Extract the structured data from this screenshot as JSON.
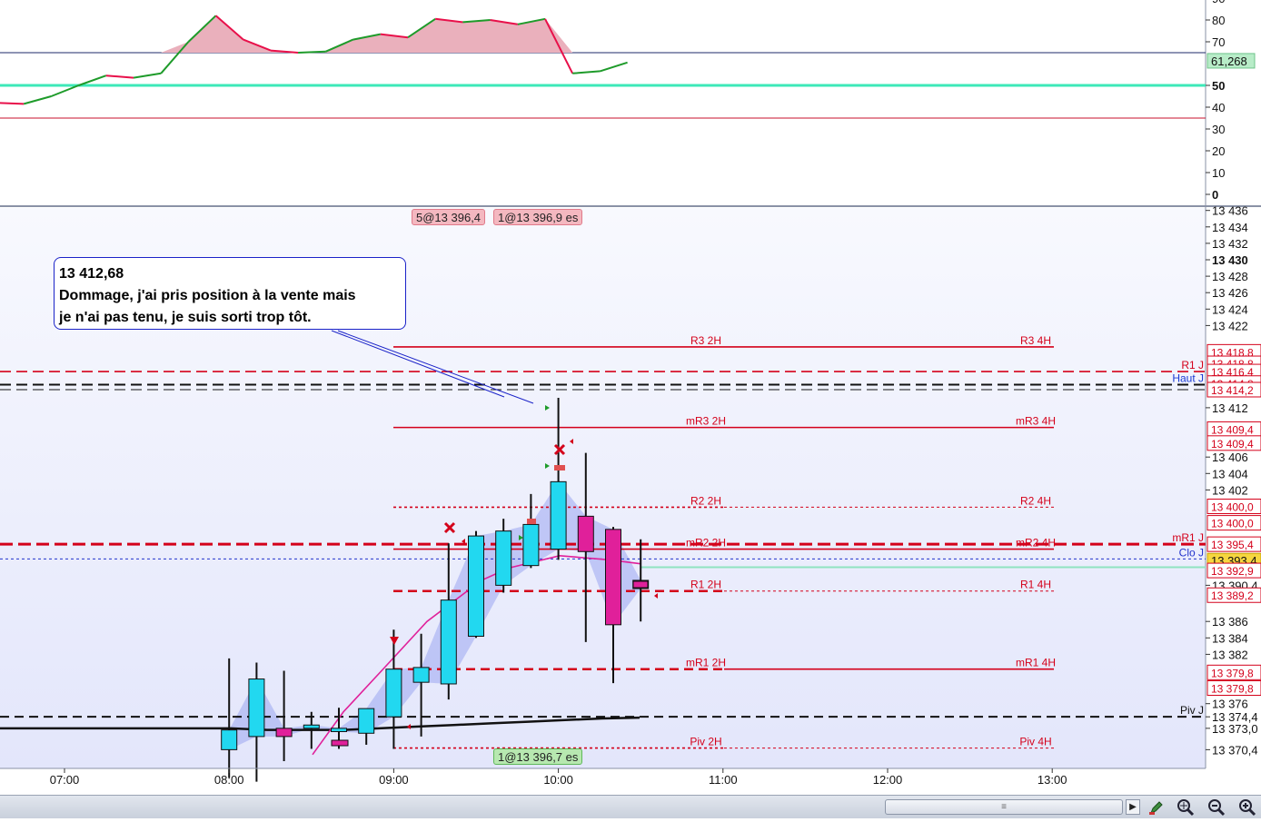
{
  "colors": {
    "rsi_line_up": "#1e9b2a",
    "rsi_line_down": "#e8104a",
    "rsi_fill": "#eab0bc",
    "rsi_level50": "#3de8b8",
    "bull_candle": "#22d8f0",
    "bear_candle": "#e0209a",
    "level_red": "#d4001a",
    "ma_black": "#111111",
    "ma_pink": "#e0209a",
    "band_fill": "#9aa6f0"
  },
  "oscillator": {
    "y_ticks": [
      "90",
      "80",
      "70",
      "61,268",
      "50",
      "40",
      "30",
      "20",
      "10",
      "0"
    ],
    "current_value": "61,268",
    "upper_level": 65,
    "mid_level": 50,
    "lower_level": 35,
    "values": [
      42,
      41.5,
      45,
      50,
      54.5,
      53.5,
      55.5,
      70,
      82,
      71,
      66,
      65,
      65.5,
      71,
      73.5,
      72,
      80.5,
      79,
      80,
      78,
      80.5,
      55.5,
      56.5,
      60.5
    ]
  },
  "price_axis": {
    "ticks": [
      "13 436",
      "13 434",
      "13 432",
      "13 430",
      "13 428",
      "13 426",
      "13 424",
      "13 422",
      "13 412",
      "13 406",
      "13 404",
      "13 402",
      "13 390,4",
      "13 386",
      "13 384",
      "13 382",
      "13 376",
      "13 374,4",
      "13 373,0",
      "13 370,4"
    ],
    "tags": [
      {
        "text": "13 418,8",
        "value": 13418.8
      },
      {
        "text": "13 418,8",
        "value": 13417.4
      },
      {
        "text": "13 416,4",
        "value": 13416.4
      },
      {
        "text": "13 414,8",
        "value": 13415.0
      },
      {
        "text": "13 414,2",
        "value": 13414.2
      },
      {
        "text": "13 409,4",
        "value": 13409.4
      },
      {
        "text": "13 409,4",
        "value": 13407.7
      },
      {
        "text": "13 400,0",
        "value": 13400.0
      },
      {
        "text": "13 400,0",
        "value": 13398.0
      },
      {
        "text": "13 395,4",
        "value": 13395.4
      },
      {
        "text": "13 393,4",
        "value": 13393.4
      },
      {
        "text": "13 392,9",
        "value": 13392.2
      },
      {
        "text": "13 389,2",
        "value": 13389.2
      },
      {
        "text": "13 379,8",
        "value": 13379.8
      },
      {
        "text": "13 379,8",
        "value": 13377.9
      }
    ],
    "current_price": "13 393,4"
  },
  "time_axis": {
    "labels": [
      "07:00",
      "08:00",
      "09:00",
      "10:00",
      "11:00",
      "12:00",
      "13:00"
    ]
  },
  "chart_data": {
    "type": "candlestick",
    "interval": "10 min",
    "candles": [
      {
        "t": "08:00",
        "o": 13370.4,
        "h": 13381.5,
        "l": 13367.0,
        "c": 13372.8
      },
      {
        "t": "08:10",
        "o": 13372.0,
        "h": 13381.0,
        "l": 13366.5,
        "c": 13379.0
      },
      {
        "t": "08:20",
        "o": 13373.0,
        "h": 13380.0,
        "l": 13369.0,
        "c": 13372.0
      },
      {
        "t": "08:30",
        "o": 13373.0,
        "h": 13375.0,
        "l": 13370.5,
        "c": 13373.4
      },
      {
        "t": "08:40",
        "o": 13372.6,
        "h": 13375.5,
        "l": 13370.5,
        "c": 13373.0
      },
      {
        "t": "08:50",
        "o": 13372.4,
        "h": 13375.0,
        "l": 13371.0,
        "c": 13375.4
      },
      {
        "t": "09:00",
        "o": 13374.4,
        "h": 13385.0,
        "l": 13370.5,
        "c": 13380.2
      },
      {
        "t": "09:10",
        "o": 13378.6,
        "h": 13384.5,
        "l": 13372.0,
        "c": 13380.4
      },
      {
        "t": "09:20",
        "o": 13378.4,
        "h": 13395.5,
        "l": 13376.5,
        "c": 13388.6
      },
      {
        "t": "09:30",
        "o": 13384.2,
        "h": 13397.0,
        "l": 13384.0,
        "c": 13396.4
      },
      {
        "t": "09:40",
        "o": 13390.4,
        "h": 13398.5,
        "l": 13389.5,
        "c": 13397.0
      },
      {
        "t": "09:50",
        "o": 13392.8,
        "h": 13401.5,
        "l": 13392.5,
        "c": 13397.8
      },
      {
        "t": "10:00",
        "o": 13394.8,
        "h": 13413.2,
        "l": 13393.5,
        "c": 13403.0
      },
      {
        "t": "10:10",
        "o": 13398.8,
        "h": 13406.5,
        "l": 13383.5,
        "c": 13394.5
      },
      {
        "t": "10:20",
        "o": 13397.2,
        "h": 13397.5,
        "l": 13378.5,
        "c": 13385.6
      },
      {
        "t": "10:30",
        "o": 13391.0,
        "h": 13396.0,
        "l": 13386.0,
        "c": 13390.0
      }
    ],
    "ma_black": [
      13373.0,
      13373.0,
      13372.8,
      13372.8,
      13372.8,
      13373.0,
      13373.2,
      13373.4,
      13373.6,
      13373.8,
      13374.0,
      13374.2,
      13374.3
    ],
    "ma_pink": [
      13369.8,
      13375.0,
      13380.0,
      13386.0,
      13391.0,
      13392.5,
      13394.0,
      13393.5,
      13393.0
    ],
    "levels_2h": [
      {
        "label": "R3 2H",
        "value": 13419.4,
        "style": "solid"
      },
      {
        "label": "mR3 2H",
        "value": 13409.6,
        "style": "solid"
      },
      {
        "label": "R2 2H",
        "value": 13399.9,
        "style": "dotted"
      },
      {
        "label": "mR2 2H",
        "value": 13394.8,
        "style": "solid"
      },
      {
        "label": "R1 2H",
        "value": 13389.7,
        "style": "dashed"
      },
      {
        "label": "mR1 2H",
        "value": 13380.2,
        "style": "dashed"
      },
      {
        "label": "Piv 2H",
        "value": 13370.6,
        "style": "dotted"
      }
    ],
    "levels_4h": [
      {
        "label": "R3 4H",
        "value": 13419.4,
        "style": "solid"
      },
      {
        "label": "mR3 4H",
        "value": 13409.6,
        "style": "solid"
      },
      {
        "label": "R2 4H",
        "value": 13399.9,
        "style": "dotted"
      },
      {
        "label": "mR2 4H",
        "value": 13394.8,
        "style": "solid"
      },
      {
        "label": "R1 4H",
        "value": 13389.7,
        "style": "dotted"
      },
      {
        "label": "mR1 4H",
        "value": 13380.2,
        "style": "solid"
      },
      {
        "label": "Piv 4H",
        "value": 13370.6,
        "style": "dotted"
      }
    ],
    "levels_daily": [
      {
        "label": "R1 J",
        "value": 13416.4
      },
      {
        "label": "Haut J",
        "value": 13414.8
      },
      {
        "label": "mR1 J",
        "value": 13395.4
      },
      {
        "label": "Clo J",
        "value": 13393.6
      },
      {
        "label": "Piv J",
        "value": 13374.4
      }
    ]
  },
  "annotation": {
    "price": "13 412,68",
    "line1": "Dommage, j'ai pris position à la vente mais",
    "line2": "je n'ai pas tenu, je suis sorti trop tôt."
  },
  "orders": {
    "sell1": "5@13 396,4",
    "sell2": "1@13 396,9 es",
    "buy1": "1@13 396,7 es"
  },
  "toolbar": {
    "scroll_grip": "≡",
    "scroll_arrow": "▶",
    "tool_icons": [
      "edit-tool-icon",
      "zoom-fit-icon",
      "zoom-out-icon",
      "zoom-in-icon"
    ]
  }
}
